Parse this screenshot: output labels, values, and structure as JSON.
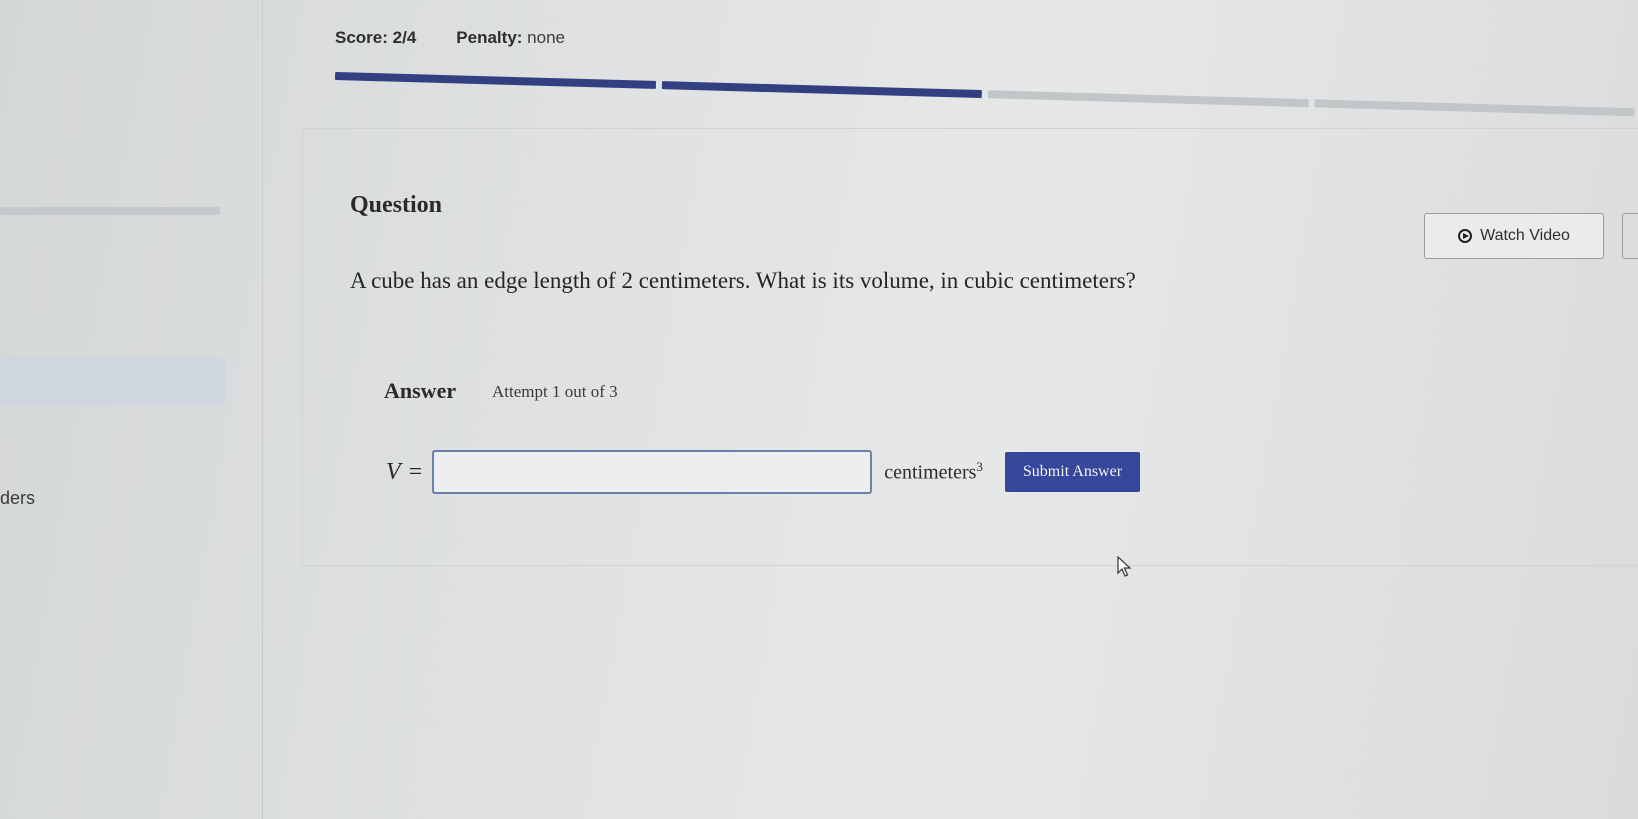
{
  "header": {
    "score_label": "Score:",
    "score_value": "2/4",
    "penalty_label": "Penalty:",
    "penalty_value": "none"
  },
  "progress": {
    "segments": [
      {
        "state": "filled",
        "color": "#323f80"
      },
      {
        "state": "filled",
        "color": "#323f80"
      },
      {
        "state": "empty",
        "color": "#c3c6c8"
      },
      {
        "state": "empty",
        "color": "#c3c6c8"
      }
    ]
  },
  "sidebar": {
    "partial_label": "ders"
  },
  "question": {
    "title": "Question",
    "text": "A cube has an edge length of 2 centimeters. What is its volume, in cubic centimeters?",
    "watch_video_label": "Watch Video"
  },
  "answer": {
    "title": "Answer",
    "attempt_text": "Attempt 1 out of 3",
    "variable": "V",
    "equals": "=",
    "input_value": "",
    "unit": "centimeters",
    "unit_exponent": "3",
    "submit_label": "Submit Answer"
  },
  "colors": {
    "accent": "#34479a",
    "progress_filled": "#323f80",
    "progress_empty": "#c3c6c8"
  }
}
